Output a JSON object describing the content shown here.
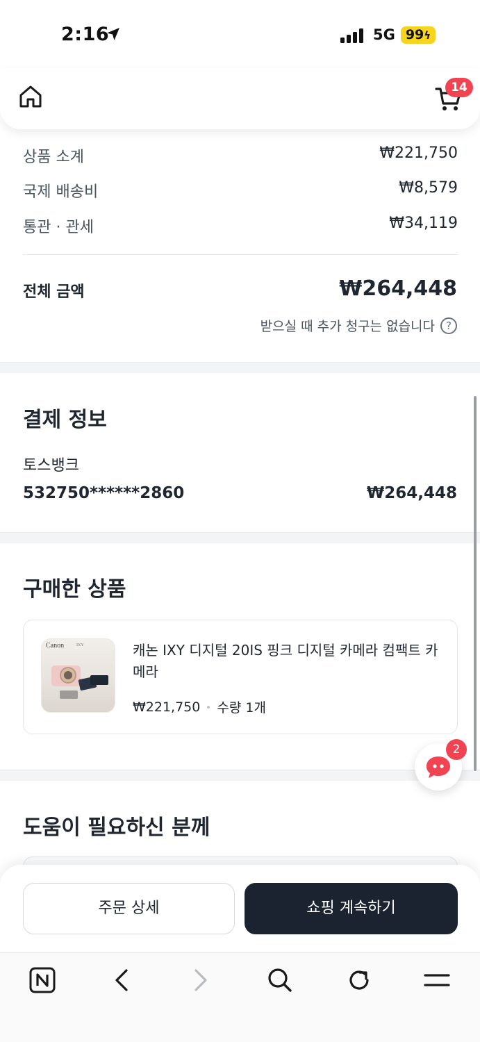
{
  "status_bar": {
    "time": "2:16",
    "network": "5G",
    "battery": "99"
  },
  "header": {
    "cart_count": "14"
  },
  "summary": {
    "subtotal_label": "상품 소계",
    "subtotal_value": "₩221,750",
    "shipping_label": "국제 배송비",
    "shipping_value": "₩8,579",
    "customs_label": "통관 · 관세",
    "customs_value": "₩34,119",
    "total_label": "전체 금액",
    "total_value": "₩264,448",
    "note": "받으실 때 추가 청구는 없습니다",
    "help_icon_glyph": "?"
  },
  "payment": {
    "title": "결제 정보",
    "bank": "토스뱅크",
    "card_number": "532750******2860",
    "amount": "₩264,448"
  },
  "purchased": {
    "title": "구매한 상품",
    "item": {
      "thumb_brand": "Canon",
      "thumb_model": "IXY",
      "name": "캐논 IXY 디지털 20IS 핑크 디지털 카메라 컴팩트 카메라",
      "price": "₩221,750",
      "quantity": "수량 1개"
    }
  },
  "help": {
    "title": "도움이 필요하신 분께"
  },
  "chat": {
    "badge": "2"
  },
  "actions": {
    "order_detail": "주문 상세",
    "continue_shopping": "쇼핑 계속하기"
  },
  "browser": {
    "icons": [
      "naver-n-icon",
      "back-icon",
      "forward-icon",
      "search-icon",
      "refresh-icon",
      "menu-icon"
    ]
  },
  "colors": {
    "accent_red": "#f04452",
    "dark_button": "#1c2330",
    "battery": "#f7d51e"
  }
}
